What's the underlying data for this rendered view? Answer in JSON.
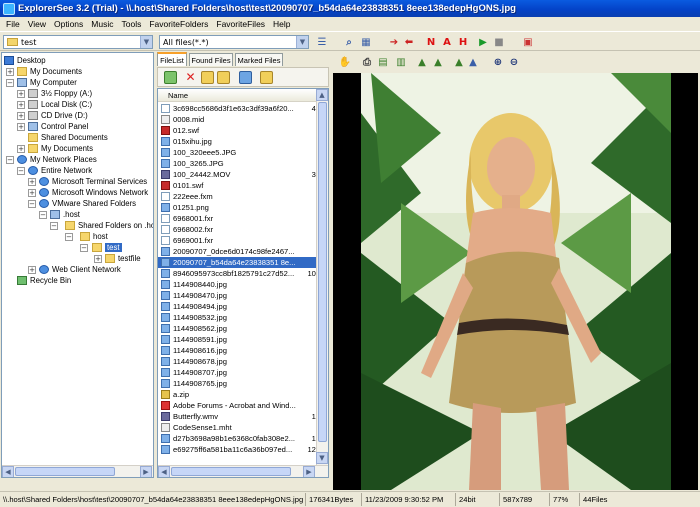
{
  "window": {
    "title": "ExplorerSee 3.2 (Trial) - \\\\.host\\Shared Folders\\host\\test\\20090707_b54da64e23838351 8eee138edepHgONS.jpg"
  },
  "menu": [
    "File",
    "View",
    "Options",
    "Music",
    "Tools",
    "FavoriteFolders",
    "FavoriteFiles",
    "Help"
  ],
  "toolbar": {
    "folder_combo": "test",
    "filter_combo": "All files(*.*)"
  },
  "tree": {
    "nodes": [
      {
        "label": "Desktop",
        "icon": "desktop-icon"
      },
      {
        "label": "My Documents",
        "icon": "folder-icon"
      },
      {
        "label": "My Computer",
        "icon": "computer-icon"
      },
      {
        "label": "3½ Floppy (A:)",
        "icon": "floppy-icon"
      },
      {
        "label": "Local Disk (C:)",
        "icon": "drive-icon"
      },
      {
        "label": "CD Drive (D:)",
        "icon": "cd-drive-icon"
      },
      {
        "label": "Control Panel",
        "icon": "control-panel-icon"
      },
      {
        "label": "Shared Documents",
        "icon": "folder-icon"
      },
      {
        "label": "My Documents",
        "icon": "folder-icon"
      },
      {
        "label": "My Network Places",
        "icon": "network-icon"
      },
      {
        "label": "Entire Network",
        "icon": "network-icon"
      },
      {
        "label": "Microsoft Terminal Services",
        "icon": "network-icon"
      },
      {
        "label": "Microsoft Windows Network",
        "icon": "network-icon"
      },
      {
        "label": "VMware Shared Folders",
        "icon": "network-icon"
      },
      {
        "label": ".host",
        "icon": "computer-icon"
      },
      {
        "label": "Shared Folders on .ho",
        "icon": "folder-icon"
      },
      {
        "label": "host",
        "icon": "folder-icon"
      },
      {
        "label": "test",
        "icon": "folder-icon"
      },
      {
        "label": "testfile",
        "icon": "folder-icon"
      },
      {
        "label": "Web Client Network",
        "icon": "network-icon"
      },
      {
        "label": "Recycle Bin",
        "icon": "recycle-bin-icon"
      }
    ]
  },
  "file_panel": {
    "tabs": [
      "FileList",
      "Found Files",
      "Marked Files"
    ],
    "column_name": "Name",
    "files": [
      {
        "name": "3c698cc5686d3f1e63c3df39a6f20...",
        "size": "4,",
        "type": "doc"
      },
      {
        "name": "0008.mid",
        "size": "",
        "type": "txt"
      },
      {
        "name": "012.swf",
        "size": "",
        "type": "swf"
      },
      {
        "name": "015xihu.jpg",
        "size": "",
        "type": "img"
      },
      {
        "name": "100_320eee5.JPG",
        "size": "",
        "type": "img"
      },
      {
        "name": "100_3265.JPG",
        "size": "",
        "type": "img"
      },
      {
        "name": "100_24442.MOV",
        "size": "3,",
        "type": "mov"
      },
      {
        "name": "0101.swf",
        "size": "",
        "type": "swf"
      },
      {
        "name": "222eee.fxm",
        "size": "",
        "type": "doc"
      },
      {
        "name": "01251.png",
        "size": "",
        "type": "img"
      },
      {
        "name": "6968001.fxr",
        "size": "",
        "type": "doc"
      },
      {
        "name": "6968002.fxr",
        "size": "",
        "type": "doc"
      },
      {
        "name": "6969001.fxr",
        "size": "",
        "type": "doc"
      },
      {
        "name": "20090707_0dce6d0174c98fe2467...",
        "size": "",
        "type": "img"
      },
      {
        "name": "20090707_b54da64e23838351 8e...",
        "size": "",
        "type": "img"
      },
      {
        "name": "8946095973cc8bf1825791c27d52...",
        "size": "10,",
        "type": "img"
      },
      {
        "name": "1144908440.jpg",
        "size": "",
        "type": "img"
      },
      {
        "name": "1144908470.jpg",
        "size": "",
        "type": "img"
      },
      {
        "name": "1144908494.jpg",
        "size": "",
        "type": "img"
      },
      {
        "name": "1144908532.jpg",
        "size": "",
        "type": "img"
      },
      {
        "name": "1144908562.jpg",
        "size": "",
        "type": "img"
      },
      {
        "name": "1144908591.jpg",
        "size": "",
        "type": "img"
      },
      {
        "name": "1144908616.jpg",
        "size": "",
        "type": "img"
      },
      {
        "name": "1144908678.jpg",
        "size": "",
        "type": "img"
      },
      {
        "name": "1144908707.jpg",
        "size": "",
        "type": "img"
      },
      {
        "name": "1144908765.jpg",
        "size": "",
        "type": "img"
      },
      {
        "name": "a.zip",
        "size": "",
        "type": "zip"
      },
      {
        "name": "Adobe Forums - Acrobat and Wind...",
        "size": "",
        "type": "pdf"
      },
      {
        "name": "Butterfly.wmv",
        "size": "1,",
        "type": "mov"
      },
      {
        "name": "CodeSense1.mht",
        "size": "",
        "type": "txt"
      },
      {
        "name": "d27b3698a98b1e6368c0fab308e2...",
        "size": "1,",
        "type": "img"
      },
      {
        "name": "e69275ff6a581ba11c6a36b097ed...",
        "size": "12,",
        "type": "img"
      }
    ],
    "selected_index": 14
  },
  "status": {
    "path": "\\\\.host\\Shared Folders\\host\\test\\20090707_b54da64e23838351 8eee138edepHgONS.jpg",
    "size": "176341Bytes",
    "date": "11/23/2009 9:30:52 PM",
    "depth": "24bit",
    "dimensions": "587x789",
    "zoom": "77%",
    "count": "44Files"
  }
}
